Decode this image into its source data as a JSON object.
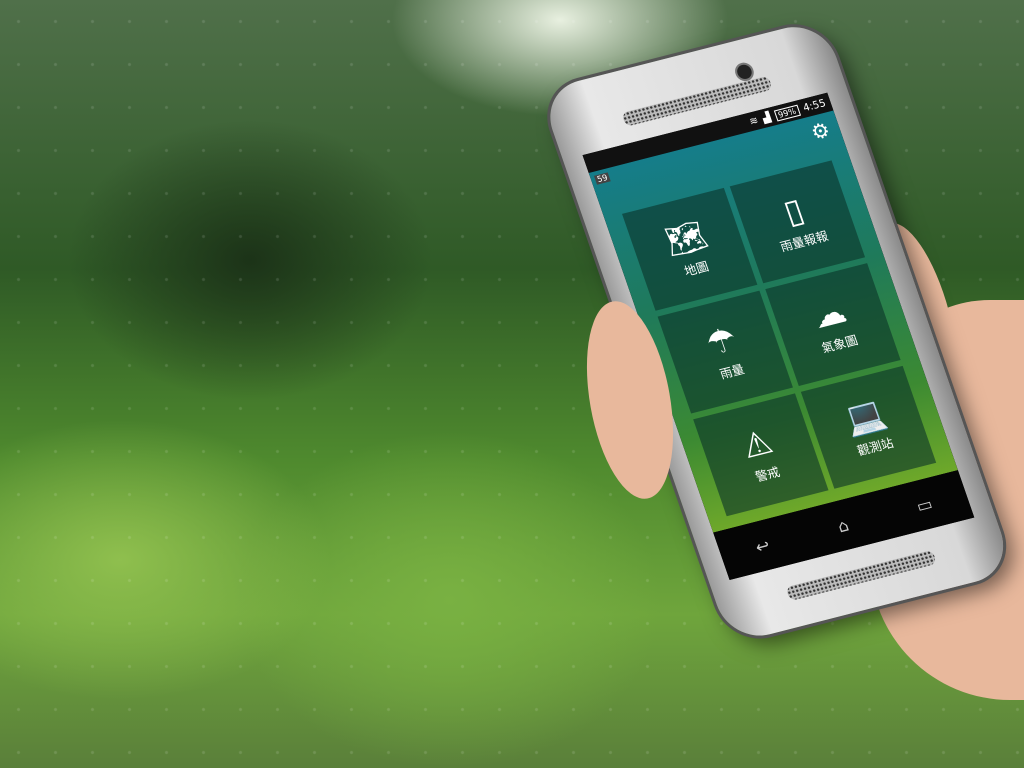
{
  "status_bar": {
    "battery": "99%",
    "time": "4:55",
    "notification_badge": "59"
  },
  "app": {
    "settings_icon": "gear-icon",
    "tiles": [
      {
        "label": "地圖",
        "icon": "map-pin-icon"
      },
      {
        "label": "雨量報報",
        "icon": "rain-gauge-icon"
      },
      {
        "label": "雨量",
        "icon": "umbrella-icon"
      },
      {
        "label": "氣象圖",
        "icon": "cloud-icon"
      },
      {
        "label": "警戒",
        "icon": "warning-icon"
      },
      {
        "label": "觀測站",
        "icon": "laptop-icon"
      }
    ]
  },
  "nav": {
    "back": "↩",
    "home": "⌂",
    "recents": "▭"
  }
}
